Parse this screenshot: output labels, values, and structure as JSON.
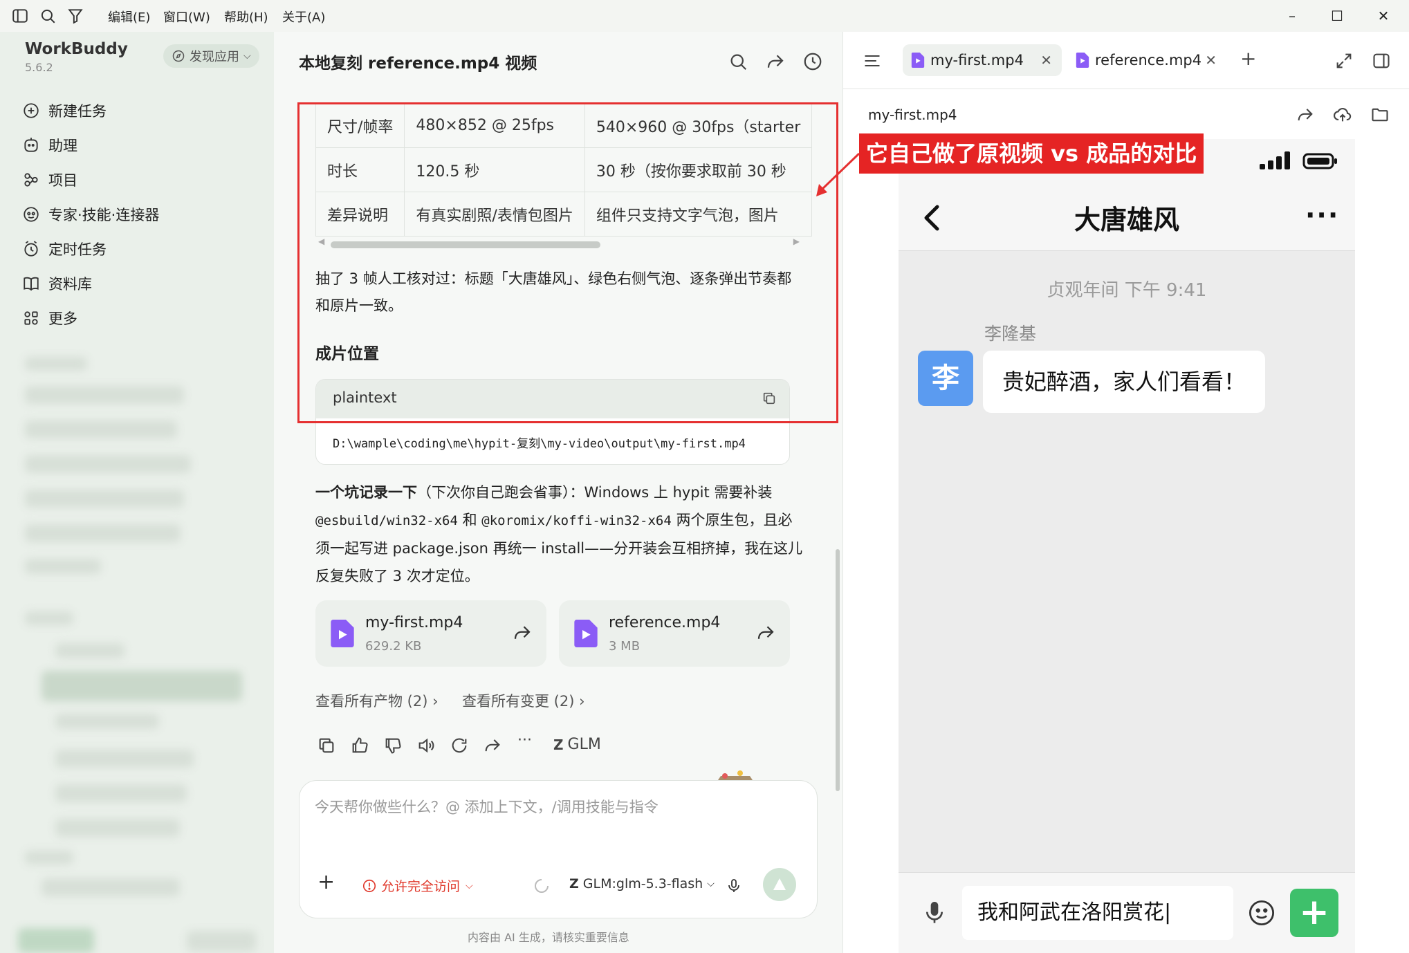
{
  "menubar": {
    "menus": [
      "编辑(E)",
      "窗口(W)",
      "帮助(H)",
      "关于(A)"
    ]
  },
  "sidebar": {
    "app_name": "WorkBuddy",
    "version": "5.6.2",
    "discover_label": "发现应用",
    "nav": [
      {
        "label": "新建任务",
        "icon": "new-task-icon"
      },
      {
        "label": "助理",
        "icon": "assistant-icon"
      },
      {
        "label": "项目",
        "icon": "project-icon"
      },
      {
        "label": "专家·技能·连接器",
        "icon": "expert-icon"
      },
      {
        "label": "定时任务",
        "icon": "schedule-icon"
      },
      {
        "label": "资料库",
        "icon": "library-icon"
      },
      {
        "label": "更多",
        "icon": "more-icon"
      }
    ]
  },
  "chat": {
    "title": "本地复刻 reference.mp4 视频",
    "table": [
      [
        "尺寸/帧率",
        "480×852 @ 25fps",
        "540×960 @ 30fps（starter"
      ],
      [
        "时长",
        "120.5 秒",
        "30 秒（按你要求取前 30 秒"
      ],
      [
        "差异说明",
        "有真实剧照/表情包图片",
        "组件只支持文字气泡，图片"
      ]
    ],
    "para1": "抽了 3 帧人工核对过：标题「大唐雄风」、绿色右侧气泡、逐条弹出节奏都和原片一致。",
    "section_title": "成片位置",
    "code_lang": "plaintext",
    "code_text": "D:\\wample\\coding\\me\\hypit-复刻\\my-video\\output\\my-first.mp4",
    "para2_bold": "一个坑记录一下",
    "para2_a": "（下次你自己跑会省事）：Windows 上 hypit 需要补装 ",
    "para2_code1": "@esbuild/win32-x64",
    "para2_b": " 和 ",
    "para2_code2": "@koromix/koffi-win32-x64",
    "para2_c": " 两个原生包，且必须一起写进 package.json 再统一 install——分开装会互相挤掉，我在这儿反复失败了 3 次才定位。",
    "files": [
      {
        "name": "my-first.mp4",
        "size": "629.2 KB"
      },
      {
        "name": "reference.mp4",
        "size": "3 MB"
      }
    ],
    "view_artifacts": "查看所有产物 (2)",
    "view_changes": "查看所有变更 (2)",
    "model_badge": "GLM",
    "input_placeholder": "今天帮你做些什么？@ 添加上下文，/调用技能与指令",
    "permission_label": "允许完全访问",
    "model_select": "GLM:glm-5.3-flash",
    "footer_note": "内容由 AI 生成，请核实重要信息"
  },
  "preview": {
    "tabs": [
      {
        "label": "my-first.mp4",
        "active": true
      },
      {
        "label": "reference.mp4",
        "active": false
      }
    ],
    "file_label": "my-first.mp4",
    "phone": {
      "title": "大唐雄风",
      "timestamp": "贞观年间 下午 9:41",
      "sender": "李隆基",
      "avatar_char": "李",
      "message": "贵妃醉酒，家人们看看！",
      "input_text": "我和阿武在洛阳赏花|"
    }
  },
  "annotation": {
    "text": "它自己做了原视频 vs 成品的对比",
    "color": "#e52424"
  },
  "colors": {
    "accent_green": "#3ec06b",
    "video_purple": "#8b5cf6",
    "avatar_blue": "#5b9bf0",
    "warning_red": "#e0392c"
  }
}
